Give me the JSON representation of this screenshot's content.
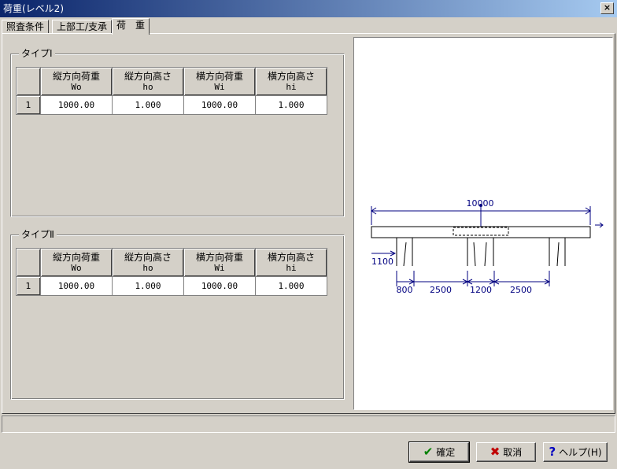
{
  "window": {
    "title": "荷重(レベル2)",
    "close_label": "×"
  },
  "tabs": [
    {
      "label": "照査条件"
    },
    {
      "label": "上部工/支承"
    },
    {
      "label": "荷　重",
      "active": true
    }
  ],
  "groups": [
    {
      "title": "タイプⅠ",
      "columns": [
        {
          "label": "縦方向荷重",
          "sub": "Wo"
        },
        {
          "label": "縦方向高さ",
          "sub": "ho"
        },
        {
          "label": "横方向荷重",
          "sub": "Wi"
        },
        {
          "label": "横方向高さ",
          "sub": "hi"
        }
      ],
      "rows": [
        {
          "num": "1",
          "cells": [
            "1000.00",
            "1.000",
            "1000.00",
            "1.000"
          ]
        }
      ]
    },
    {
      "title": "タイプⅡ",
      "columns": [
        {
          "label": "縦方向荷重",
          "sub": "Wo"
        },
        {
          "label": "縦方向高さ",
          "sub": "ho"
        },
        {
          "label": "横方向荷重",
          "sub": "Wi"
        },
        {
          "label": "横方向高さ",
          "sub": "hi"
        }
      ],
      "rows": [
        {
          "num": "1",
          "cells": [
            "1000.00",
            "1.000",
            "1000.00",
            "1.000"
          ]
        }
      ]
    }
  ],
  "diagram": {
    "total_width": "10000",
    "overhang": "1100",
    "spacings": [
      "800",
      "2500",
      "1200",
      "2500"
    ],
    "line_color": "#000080"
  },
  "buttons": {
    "ok": {
      "label": "確定",
      "icon": "check-icon"
    },
    "cancel": {
      "label": "取消",
      "icon": "x-icon"
    },
    "help": {
      "label": "ヘルプ(H)",
      "icon": "question-icon"
    }
  }
}
